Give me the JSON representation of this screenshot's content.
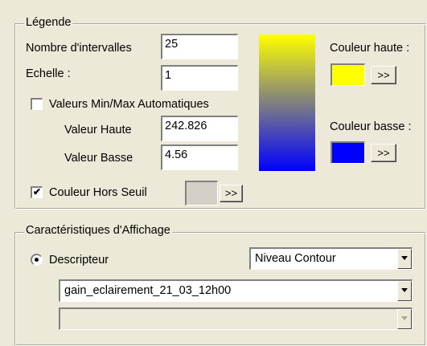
{
  "legende": {
    "title": "Légende",
    "nombre_intervalles": {
      "label": "Nombre d'intervalles",
      "value": "25"
    },
    "echelle": {
      "label": "Echelle :",
      "value": "1"
    },
    "auto_minmax": {
      "label": "Valeurs Min/Max Automatiques",
      "checked": false
    },
    "valeur_haute": {
      "label": "Valeur Haute",
      "value": "242.826"
    },
    "valeur_basse": {
      "label": "Valeur Basse",
      "value": "4.56"
    },
    "hors_seuil": {
      "label": "Couleur Hors Seuil",
      "checked": true,
      "check_glyph": "✔",
      "color": "#D4D0C8",
      "button": ">>"
    },
    "couleur_haute": {
      "label": "Couleur haute :",
      "color": "#FFFF00",
      "button": ">>"
    },
    "couleur_basse": {
      "label": "Couleur basse :",
      "color": "#0000FF",
      "button": ">>"
    },
    "gradient": {
      "top": "#FFFF00",
      "middle": "#808080",
      "bottom": "#0000FF"
    }
  },
  "affichage": {
    "title": "Caractéristiques d'Affichage",
    "descripteur": {
      "label": "Descripteur",
      "selected": true
    },
    "mode_select": {
      "value": "Niveau Contour"
    },
    "dataset_select": {
      "value": "gain_eclairement_21_03_12h00"
    },
    "secondary_select": {
      "value": ""
    }
  }
}
